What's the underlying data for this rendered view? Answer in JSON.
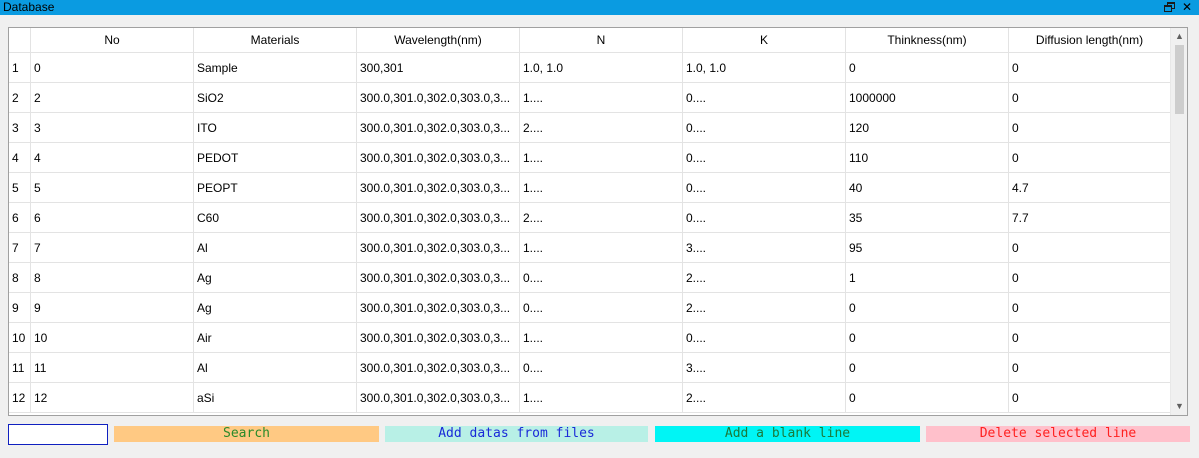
{
  "window": {
    "title": "Database",
    "restore_icon": "restore-window-icon",
    "close_glyph": "✕"
  },
  "table": {
    "columns": [
      "No",
      "Materials",
      "Wavelength(nm)",
      "N",
      "K",
      "Thinkness(nm)",
      "Diffusion length(nm)"
    ],
    "rows": [
      {
        "index": "1",
        "cells": [
          "0",
          "Sample",
          "300,301",
          "1.0, 1.0",
          "1.0, 1.0",
          "0",
          "0"
        ]
      },
      {
        "index": "2",
        "cells": [
          "2",
          "SiO2",
          "300.0,301.0,302.0,303.0,3...",
          "1....",
          "0....",
          "1000000",
          "0"
        ]
      },
      {
        "index": "3",
        "cells": [
          "3",
          "ITO",
          "300.0,301.0,302.0,303.0,3...",
          "2....",
          "0....",
          "120",
          "0"
        ]
      },
      {
        "index": "4",
        "cells": [
          "4",
          "PEDOT",
          "300.0,301.0,302.0,303.0,3...",
          "1....",
          "0....",
          "110",
          "0"
        ]
      },
      {
        "index": "5",
        "cells": [
          "5",
          "PEOPT",
          "300.0,301.0,302.0,303.0,3...",
          "1....",
          "0....",
          "40",
          "4.7"
        ]
      },
      {
        "index": "6",
        "cells": [
          "6",
          "C60",
          "300.0,301.0,302.0,303.0,3...",
          "2....",
          "0....",
          "35",
          "7.7"
        ]
      },
      {
        "index": "7",
        "cells": [
          "7",
          "Al",
          "300.0,301.0,302.0,303.0,3...",
          "1....",
          "3....",
          "95",
          "0"
        ]
      },
      {
        "index": "8",
        "cells": [
          "8",
          "Ag",
          "300.0,301.0,302.0,303.0,3...",
          "0....",
          "2....",
          "1",
          "0"
        ]
      },
      {
        "index": "9",
        "cells": [
          "9",
          "Ag",
          "300.0,301.0,302.0,303.0,3...",
          "0....",
          "2....",
          "0",
          "0"
        ]
      },
      {
        "index": "10",
        "cells": [
          "10",
          "Air",
          "300.0,301.0,302.0,303.0,3...",
          "1....",
          "0....",
          "0",
          "0"
        ]
      },
      {
        "index": "11",
        "cells": [
          "11",
          "Al",
          "300.0,301.0,302.0,303.0,3...",
          "0....",
          "3....",
          "0",
          "0"
        ]
      },
      {
        "index": "12",
        "cells": [
          "12",
          "aSi",
          "300.0,301.0,302.0,303.0,3...",
          "1....",
          "2....",
          "0",
          "0"
        ]
      }
    ],
    "scroll_position": 0.0
  },
  "toolbar": {
    "search_value": "",
    "search_label": "Search",
    "add_files_label": "Add datas from files",
    "add_blank_label": "Add a blank line",
    "delete_label": "Delete selected line",
    "colors": {
      "search_bg": "#ffc983",
      "search_fg": "#2a8a2a",
      "add_files_bg": "#b8f0e6",
      "add_files_fg": "#1a2ad8",
      "add_blank_bg": "#00f5f5",
      "add_blank_fg": "#1a7a3a",
      "delete_bg": "#ffc0cb",
      "delete_fg": "#ff2020"
    }
  },
  "colors": {
    "titlebar": "#0a9be1"
  }
}
